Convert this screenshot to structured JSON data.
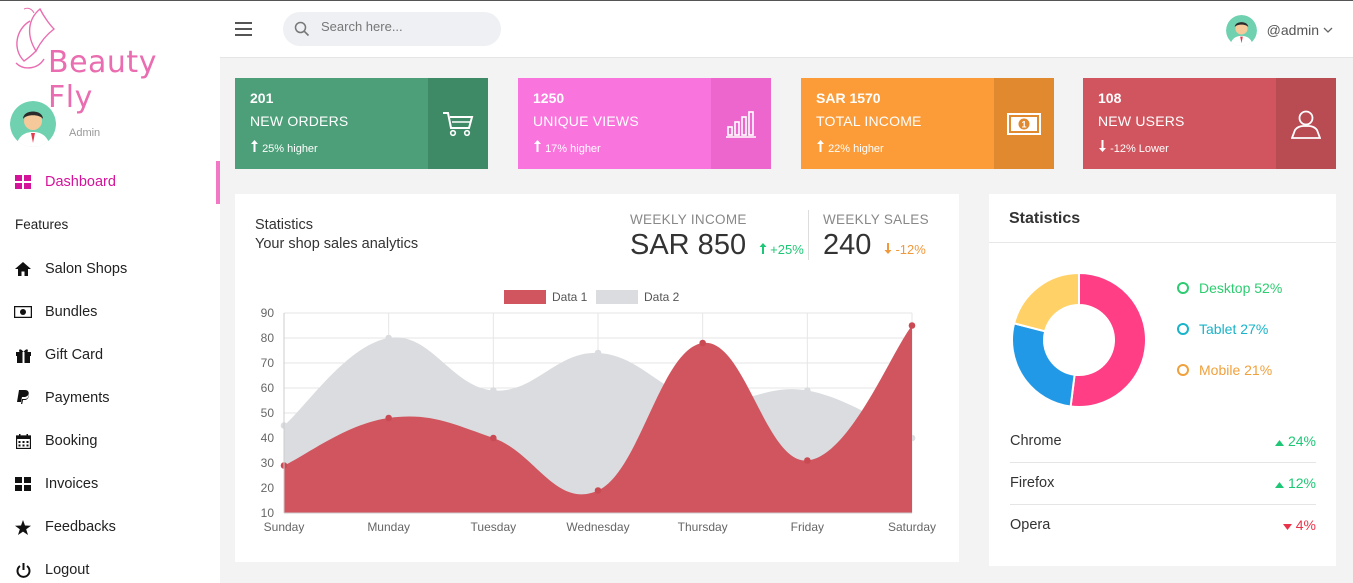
{
  "brand": {
    "name": "Beauty Fly",
    "color": "#e96db0"
  },
  "sidebar": {
    "role": "Admin",
    "section_label": "Features",
    "items": [
      {
        "label": "Dashboard",
        "icon": "dashboard-grid-icon",
        "active": true
      },
      {
        "label": "Salon Shops",
        "icon": "home-icon"
      },
      {
        "label": "Bundles",
        "icon": "money-icon"
      },
      {
        "label": "Gift Card",
        "icon": "gift-icon"
      },
      {
        "label": "Payments",
        "icon": "paypal-icon"
      },
      {
        "label": "Booking",
        "icon": "calendar-icon"
      },
      {
        "label": "Invoices",
        "icon": "grid-icon"
      },
      {
        "label": "Feedbacks",
        "icon": "star-icon"
      },
      {
        "label": "Logout",
        "icon": "power-icon"
      }
    ]
  },
  "header": {
    "search_placeholder": "Search here...",
    "username": "@admin"
  },
  "cards": [
    {
      "value": "201",
      "title": "NEW ORDERS",
      "sub": "25% higher",
      "color": "#4c9f78",
      "icon_bg": "#3f8a66",
      "icon": "cart-icon",
      "trend": "up"
    },
    {
      "value": "1250",
      "title": "UNIQUE VIEWS",
      "sub": "17% higher",
      "color": "#fa74dd",
      "icon_bg": "#ed66cd",
      "icon": "bar-chart-icon",
      "trend": "up"
    },
    {
      "value": "SAR 1570",
      "title": "TOTAL INCOME",
      "sub": "22% higher",
      "color": "#fb9c38",
      "icon_bg": "#e0892f",
      "icon": "money-icon",
      "trend": "up"
    },
    {
      "value": "108",
      "title": "NEW USERS",
      "sub": "-12% Lower",
      "color": "#d0555e",
      "icon_bg": "#b94b53",
      "icon": "user-icon",
      "trend": "down"
    }
  ],
  "statistics": {
    "title": "Statistics",
    "subtitle": "Your shop sales analytics",
    "weekly_income": {
      "label": "WEEKLY INCOME",
      "value": "SAR 850",
      "delta": "+25%",
      "color": "#1ec775"
    },
    "weekly_sales": {
      "label": "WEEKLY SALES",
      "value": "240",
      "delta": "-12%",
      "color": "#f0993c"
    }
  },
  "chart_data": {
    "type": "area",
    "categories": [
      "Sunday",
      "Munday",
      "Tuesday",
      "Wednesday",
      "Thursday",
      "Friday",
      "Saturday"
    ],
    "series": [
      {
        "name": "Data 1",
        "values": [
          29,
          48,
          40,
          19,
          78,
          31,
          85
        ],
        "color": "#d0555e"
      },
      {
        "name": "Data 2",
        "values": [
          45,
          80,
          59,
          74,
          55,
          59,
          40
        ],
        "color": "#dadcdf"
      }
    ],
    "yticks": [
      10,
      20,
      30,
      40,
      50,
      60,
      70,
      80,
      90
    ],
    "ylim": [
      10,
      90
    ],
    "grid": true,
    "legend_position": "top"
  },
  "browser_stats": {
    "title": "Statistics",
    "donut": [
      {
        "label": "Desktop 52%",
        "value": 52,
        "color": "#ff3e85",
        "text_color": "#2ecc71",
        "ring": "#2ecc71"
      },
      {
        "label": "Tablet 27%",
        "value": 27,
        "color": "#2299e6",
        "text_color": "#19b4c9",
        "ring": "#19b4c9"
      },
      {
        "label": "Mobile 21%",
        "value": 21,
        "color": "#ffd166",
        "text_color": "#f0a13c",
        "ring": "#f0a13c"
      }
    ],
    "browsers": [
      {
        "name": "Chrome",
        "value": "24%",
        "trend": "up",
        "color": "#1ec775"
      },
      {
        "name": "Firefox",
        "value": "12%",
        "trend": "up",
        "color": "#1ec775"
      },
      {
        "name": "Opera",
        "value": "4%",
        "trend": "down",
        "color": "#e8334a"
      }
    ]
  }
}
